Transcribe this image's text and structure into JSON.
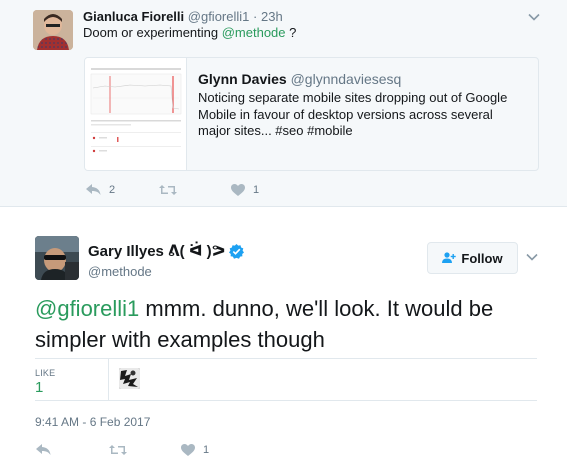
{
  "parent_tweet": {
    "author_name": "Gianluca Fiorelli",
    "handle": "@gfiorelli1",
    "separator": "·",
    "time": "23h",
    "text_prefix": "Doom or experimenting ",
    "mention": "@methode",
    "text_suffix": " ?",
    "quoted": {
      "author_name": "Glynn Davies",
      "handle": "@glynndaviesesq",
      "text": "Noticing separate mobile sites dropping out of Google Mobile in favour of desktop versions across several major sites... #seo #mobile"
    },
    "actions": {
      "reply_count": "2",
      "retweet_count": "",
      "like_count": "1"
    }
  },
  "main_tweet": {
    "author_name": "Gary Illyes ᕕ( ᐛ )ᕗ",
    "handle": "@methode",
    "verified": true,
    "follow_label": "Follow",
    "mention": "@gfiorelli1",
    "text": " mmm. dunno, we'll look. It would be simpler with examples though",
    "stats": {
      "likes_label": "LIKE",
      "likes_value": "1"
    },
    "timestamp": "9:41 AM - 6 Feb 2017",
    "actions": {
      "reply_count": "",
      "retweet_count": "",
      "like_count": "1"
    }
  },
  "colors": {
    "accent": "#2a9b5d",
    "muted": "#657786",
    "border": "#e1e8ed",
    "verified": "#1da1f2",
    "parent_bg": "#f5f8fa"
  },
  "icons": {
    "reply": "reply-icon",
    "retweet": "retweet-icon",
    "like": "heart-icon",
    "menu": "chevron-down-icon",
    "follow": "add-person-icon",
    "verified": "verified-badge-icon"
  }
}
